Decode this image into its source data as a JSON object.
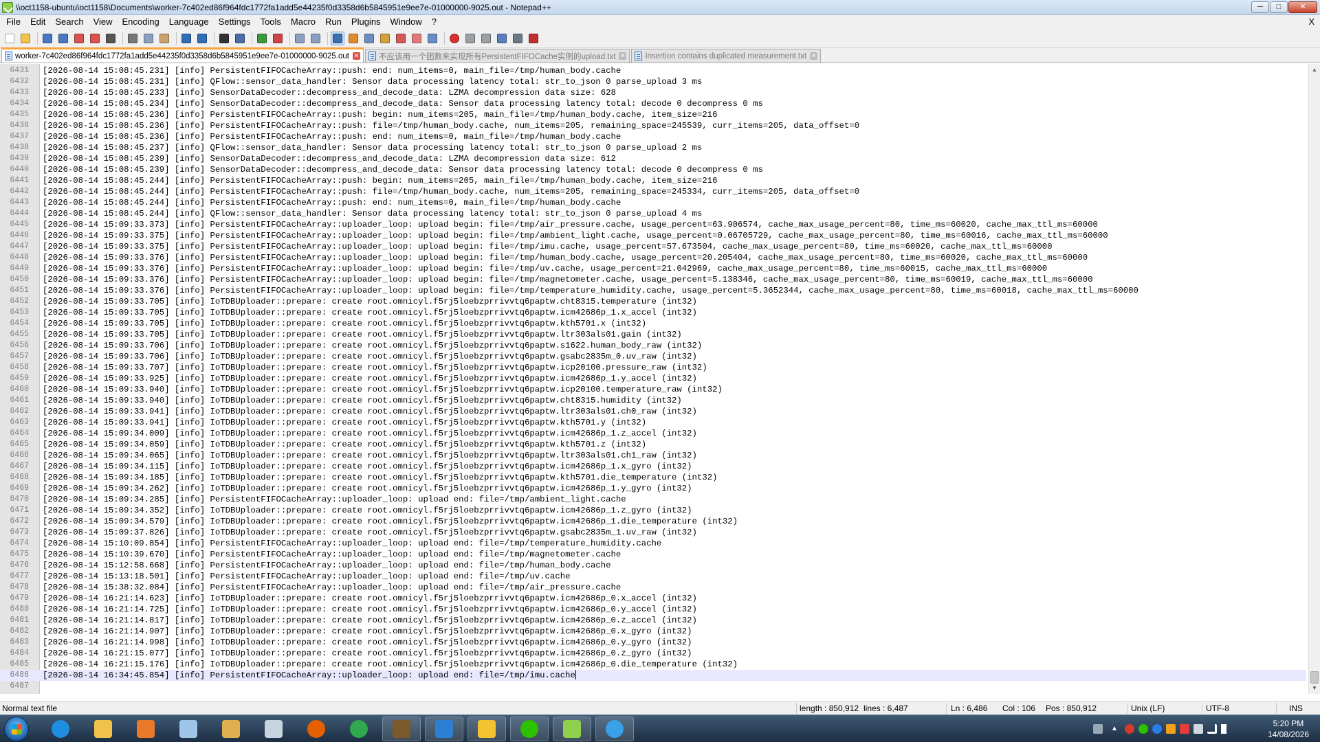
{
  "window": {
    "title": "\\\\oct1158-ubuntu\\oct1158\\Documents\\worker-7c402ed86f964fdc1772fa1add5e44235f0d3358d6b5845951e9ee7e-01000000-9025.out - Notepad++",
    "minimize_glyph": "─",
    "maximize_glyph": "□",
    "close_glyph": "✕"
  },
  "menu": {
    "items": [
      "File",
      "Edit",
      "Search",
      "View",
      "Encoding",
      "Language",
      "Settings",
      "Tools",
      "Macro",
      "Run",
      "Plugins",
      "Window",
      "?"
    ],
    "close_glyph": "X"
  },
  "toolbar": {
    "icons": [
      "new-file-icon",
      "open-file-icon",
      "save-icon",
      "save-all-icon",
      "close-icon",
      "close-all-icon",
      "print-icon",
      "cut-icon",
      "copy-icon",
      "paste-icon",
      "undo-icon",
      "redo-icon",
      "find-icon",
      "replace-icon",
      "zoom-in-icon",
      "zoom-out-icon",
      "sync-vertical-icon",
      "sync-horizontal-icon",
      "word-wrap-icon",
      "show-all-chars-icon",
      "indent-guide-icon",
      "document-map-icon",
      "function-list-icon",
      "folder-workspace-icon",
      "monitor-icon",
      "record-macro-icon",
      "stop-macro-icon",
      "play-macro-icon",
      "run-macro-multiple-icon",
      "save-macro-icon",
      "spell-check-icon"
    ]
  },
  "tabs": [
    {
      "label": "worker-7c402ed86f964fdc1772fa1add5e44235f0d3358d6b5845951e9ee7e-01000000-9025.out",
      "active": true
    },
    {
      "label": "不应该用一个团数来实现所有PersistentFIFOCache实例的upload.txt",
      "active": false
    },
    {
      "label": "Insertion contains duplicated measurement.txt",
      "active": false
    }
  ],
  "editor": {
    "current_line": 6486,
    "lines": [
      {
        "n": "6431",
        "t": "[2026-08-14 15:08:45.231] [info] PersistentFIFOCacheArray::push: end: num_items=0, main_file=/tmp/human_body.cache"
      },
      {
        "n": "6432",
        "t": "[2026-08-14 15:08:45.231] [info] QFlow::sensor_data_handler: Sensor data processing latency total: str_to_json 0 parse_upload 3 ms"
      },
      {
        "n": "6433",
        "t": "[2026-08-14 15:08:45.233] [info] SensorDataDecoder::decompress_and_decode_data: LZMA decompression data size: 628"
      },
      {
        "n": "6434",
        "t": "[2026-08-14 15:08:45.234] [info] SensorDataDecoder::decompress_and_decode_data: Sensor data processing latency total: decode 0 decompress 0 ms"
      },
      {
        "n": "6435",
        "t": "[2026-08-14 15:08:45.236] [info] PersistentFIFOCacheArray::push: begin: num_items=205, main_file=/tmp/human_body.cache, item_size=216"
      },
      {
        "n": "6436",
        "t": "[2026-08-14 15:08:45.236] [info] PersistentFIFOCacheArray::push: file=/tmp/human_body.cache, num_items=205, remaining_space=245539, curr_items=205, data_offset=0"
      },
      {
        "n": "6437",
        "t": "[2026-08-14 15:08:45.236] [info] PersistentFIFOCacheArray::push: end: num_items=0, main_file=/tmp/human_body.cache"
      },
      {
        "n": "6438",
        "t": "[2026-08-14 15:08:45.237] [info] QFlow::sensor_data_handler: Sensor data processing latency total: str_to_json 0 parse_upload 2 ms"
      },
      {
        "n": "6439",
        "t": "[2026-08-14 15:08:45.239] [info] SensorDataDecoder::decompress_and_decode_data: LZMA decompression data size: 612"
      },
      {
        "n": "6440",
        "t": "[2026-08-14 15:08:45.239] [info] SensorDataDecoder::decompress_and_decode_data: Sensor data processing latency total: decode 0 decompress 0 ms"
      },
      {
        "n": "6441",
        "t": "[2026-08-14 15:08:45.244] [info] PersistentFIFOCacheArray::push: begin: num_items=205, main_file=/tmp/human_body.cache, item_size=216"
      },
      {
        "n": "6442",
        "t": "[2026-08-14 15:08:45.244] [info] PersistentFIFOCacheArray::push: file=/tmp/human_body.cache, num_items=205, remaining_space=245334, curr_items=205, data_offset=0"
      },
      {
        "n": "6443",
        "t": "[2026-08-14 15:08:45.244] [info] PersistentFIFOCacheArray::push: end: num_items=0, main_file=/tmp/human_body.cache"
      },
      {
        "n": "6444",
        "t": "[2026-08-14 15:08:45.244] [info] QFlow::sensor_data_handler: Sensor data processing latency total: str_to_json 0 parse_upload 4 ms"
      },
      {
        "n": "6445",
        "t": "[2026-08-14 15:09:33.373] [info] PersistentFIFOCacheArray::uploader_loop: upload begin: file=/tmp/air_pressure.cache, usage_percent=63.906574, cache_max_usage_percent=80, time_ms=60020, cache_max_ttl_ms=60000"
      },
      {
        "n": "6446",
        "t": "[2026-08-14 15:09:33.375] [info] PersistentFIFOCacheArray::uploader_loop: upload begin: file=/tmp/ambient_light.cache, usage_percent=0.06705729, cache_max_usage_percent=80, time_ms=60016, cache_max_ttl_ms=60000"
      },
      {
        "n": "6447",
        "t": "[2026-08-14 15:09:33.375] [info] PersistentFIFOCacheArray::uploader_loop: upload begin: file=/tmp/imu.cache, usage_percent=57.673504, cache_max_usage_percent=80, time_ms=60020, cache_max_ttl_ms=60000"
      },
      {
        "n": "6448",
        "t": "[2026-08-14 15:09:33.376] [info] PersistentFIFOCacheArray::uploader_loop: upload begin: file=/tmp/human_body.cache, usage_percent=20.205404, cache_max_usage_percent=80, time_ms=60020, cache_max_ttl_ms=60000"
      },
      {
        "n": "6449",
        "t": "[2026-08-14 15:09:33.376] [info] PersistentFIFOCacheArray::uploader_loop: upload begin: file=/tmp/uv.cache, usage_percent=21.042969, cache_max_usage_percent=80, time_ms=60015, cache_max_ttl_ms=60000"
      },
      {
        "n": "6450",
        "t": "[2026-08-14 15:09:33.376] [info] PersistentFIFOCacheArray::uploader_loop: upload begin: file=/tmp/magnetometer.cache, usage_percent=5.138346, cache_max_usage_percent=80, time_ms=60019, cache_max_ttl_ms=60000"
      },
      {
        "n": "6451",
        "t": "[2026-08-14 15:09:33.376] [info] PersistentFIFOCacheArray::uploader_loop: upload begin: file=/tmp/temperature_humidity.cache, usage_percent=5.3652344, cache_max_usage_percent=80, time_ms=60018, cache_max_ttl_ms=60000"
      },
      {
        "n": "6452",
        "t": "[2026-08-14 15:09:33.705] [info] IoTDBUploader::prepare: create root.omnicyl.f5rj5loebzprrivvtq6paptw.cht8315.temperature (int32)"
      },
      {
        "n": "6453",
        "t": "[2026-08-14 15:09:33.705] [info] IoTDBUploader::prepare: create root.omnicyl.f5rj5loebzprrivvtq6paptw.icm42686p_1.x_accel (int32)"
      },
      {
        "n": "6454",
        "t": "[2026-08-14 15:09:33.705] [info] IoTDBUploader::prepare: create root.omnicyl.f5rj5loebzprrivvtq6paptw.kth5701.x (int32)"
      },
      {
        "n": "6455",
        "t": "[2026-08-14 15:09:33.705] [info] IoTDBUploader::prepare: create root.omnicyl.f5rj5loebzprrivvtq6paptw.ltr303als01.gain (int32)"
      },
      {
        "n": "6456",
        "t": "[2026-08-14 15:09:33.706] [info] IoTDBUploader::prepare: create root.omnicyl.f5rj5loebzprrivvtq6paptw.s1622.human_body_raw (int32)"
      },
      {
        "n": "6457",
        "t": "[2026-08-14 15:09:33.706] [info] IoTDBUploader::prepare: create root.omnicyl.f5rj5loebzprrivvtq6paptw.gsabc2835m_0.uv_raw (int32)"
      },
      {
        "n": "6458",
        "t": "[2026-08-14 15:09:33.707] [info] IoTDBUploader::prepare: create root.omnicyl.f5rj5loebzprrivvtq6paptw.icp20100.pressure_raw (int32)"
      },
      {
        "n": "6459",
        "t": "[2026-08-14 15:09:33.925] [info] IoTDBUploader::prepare: create root.omnicyl.f5rj5loebzprrivvtq6paptw.icm42686p_1.y_accel (int32)"
      },
      {
        "n": "6460",
        "t": "[2026-08-14 15:09:33.940] [info] IoTDBUploader::prepare: create root.omnicyl.f5rj5loebzprrivvtq6paptw.icp20100.temperature_raw (int32)"
      },
      {
        "n": "6461",
        "t": "[2026-08-14 15:09:33.940] [info] IoTDBUploader::prepare: create root.omnicyl.f5rj5loebzprrivvtq6paptw.cht8315.humidity (int32)"
      },
      {
        "n": "6462",
        "t": "[2026-08-14 15:09:33.941] [info] IoTDBUploader::prepare: create root.omnicyl.f5rj5loebzprrivvtq6paptw.ltr303als01.ch0_raw (int32)"
      },
      {
        "n": "6463",
        "t": "[2026-08-14 15:09:33.941] [info] IoTDBUploader::prepare: create root.omnicyl.f5rj5loebzprrivvtq6paptw.kth5701.y (int32)"
      },
      {
        "n": "6464",
        "t": "[2026-08-14 15:09:34.009] [info] IoTDBUploader::prepare: create root.omnicyl.f5rj5loebzprrivvtq6paptw.icm42686p_1.z_accel (int32)"
      },
      {
        "n": "6465",
        "t": "[2026-08-14 15:09:34.059] [info] IoTDBUploader::prepare: create root.omnicyl.f5rj5loebzprrivvtq6paptw.kth5701.z (int32)"
      },
      {
        "n": "6466",
        "t": "[2026-08-14 15:09:34.065] [info] IoTDBUploader::prepare: create root.omnicyl.f5rj5loebzprrivvtq6paptw.ltr303als01.ch1_raw (int32)"
      },
      {
        "n": "6467",
        "t": "[2026-08-14 15:09:34.115] [info] IoTDBUploader::prepare: create root.omnicyl.f5rj5loebzprrivvtq6paptw.icm42686p_1.x_gyro (int32)"
      },
      {
        "n": "6468",
        "t": "[2026-08-14 15:09:34.185] [info] IoTDBUploader::prepare: create root.omnicyl.f5rj5loebzprrivvtq6paptw.kth5701.die_temperature (int32)"
      },
      {
        "n": "6469",
        "t": "[2026-08-14 15:09:34.262] [info] IoTDBUploader::prepare: create root.omnicyl.f5rj5loebzprrivvtq6paptw.icm42686p_1.y_gyro (int32)"
      },
      {
        "n": "6470",
        "t": "[2026-08-14 15:09:34.285] [info] PersistentFIFOCacheArray::uploader_loop: upload end: file=/tmp/ambient_light.cache"
      },
      {
        "n": "6471",
        "t": "[2026-08-14 15:09:34.352] [info] IoTDBUploader::prepare: create root.omnicyl.f5rj5loebzprrivvtq6paptw.icm42686p_1.z_gyro (int32)"
      },
      {
        "n": "6472",
        "t": "[2026-08-14 15:09:34.579] [info] IoTDBUploader::prepare: create root.omnicyl.f5rj5loebzprrivvtq6paptw.icm42686p_1.die_temperature (int32)"
      },
      {
        "n": "6473",
        "t": "[2026-08-14 15:09:37.826] [info] IoTDBUploader::prepare: create root.omnicyl.f5rj5loebzprrivvtq6paptw.gsabc2835m_1.uv_raw (int32)"
      },
      {
        "n": "6474",
        "t": "[2026-08-14 15:10:09.854] [info] PersistentFIFOCacheArray::uploader_loop: upload end: file=/tmp/temperature_humidity.cache"
      },
      {
        "n": "6475",
        "t": "[2026-08-14 15:10:39.670] [info] PersistentFIFOCacheArray::uploader_loop: upload end: file=/tmp/magnetometer.cache"
      },
      {
        "n": "6476",
        "t": "[2026-08-14 15:12:58.668] [info] PersistentFIFOCacheArray::uploader_loop: upload end: file=/tmp/human_body.cache"
      },
      {
        "n": "6477",
        "t": "[2026-08-14 15:13:18.501] [info] PersistentFIFOCacheArray::uploader_loop: upload end: file=/tmp/uv.cache"
      },
      {
        "n": "6478",
        "t": "[2026-08-14 15:38:32.084] [info] PersistentFIFOCacheArray::uploader_loop: upload end: file=/tmp/air_pressure.cache"
      },
      {
        "n": "6479",
        "t": "[2026-08-14 16:21:14.623] [info] IoTDBUploader::prepare: create root.omnicyl.f5rj5loebzprrivvtq6paptw.icm42686p_0.x_accel (int32)"
      },
      {
        "n": "6480",
        "t": "[2026-08-14 16:21:14.725] [info] IoTDBUploader::prepare: create root.omnicyl.f5rj5loebzprrivvtq6paptw.icm42686p_0.y_accel (int32)"
      },
      {
        "n": "6481",
        "t": "[2026-08-14 16:21:14.817] [info] IoTDBUploader::prepare: create root.omnicyl.f5rj5loebzprrivvtq6paptw.icm42686p_0.z_accel (int32)"
      },
      {
        "n": "6482",
        "t": "[2026-08-14 16:21:14.907] [info] IoTDBUploader::prepare: create root.omnicyl.f5rj5loebzprrivvtq6paptw.icm42686p_0.x_gyro (int32)"
      },
      {
        "n": "6483",
        "t": "[2026-08-14 16:21:14.998] [info] IoTDBUploader::prepare: create root.omnicyl.f5rj5loebzprrivvtq6paptw.icm42686p_0.y_gyro (int32)"
      },
      {
        "n": "6484",
        "t": "[2026-08-14 16:21:15.077] [info] IoTDBUploader::prepare: create root.omnicyl.f5rj5loebzprrivvtq6paptw.icm42686p_0.z_gyro (int32)"
      },
      {
        "n": "6485",
        "t": "[2026-08-14 16:21:15.176] [info] IoTDBUploader::prepare: create root.omnicyl.f5rj5loebzprrivvtq6paptw.icm42686p_0.die_temperature (int32)"
      },
      {
        "n": "6486",
        "t": "[2026-08-14 16:34:45.854] [info] PersistentFIFOCacheArray::uploader_loop: upload end: file=/tmp/imu.cache"
      },
      {
        "n": "6487",
        "t": ""
      }
    ]
  },
  "status": {
    "file_type": "Normal text file",
    "length": "length : 850,912",
    "lines": "lines : 6,487",
    "ln": "Ln : 6,486",
    "col": "Col : 106",
    "pos": "Pos : 850,912",
    "eol": "Unix (LF)",
    "encoding": "UTF-8",
    "mode": "INS"
  },
  "taskbar": {
    "apps": [
      "internet-explorer-icon",
      "file-explorer-icon",
      "media-player-icon",
      "notepad-icon",
      "paint-icon",
      "calculator-icon",
      "firefox-icon",
      "chrome-icon",
      "game-icon",
      "vscode-icon",
      "text-editor-icon",
      "wechat-icon",
      "notepadpp-icon",
      "network-tool-icon"
    ],
    "time": "5:20 PM",
    "date": "14/08/2026"
  },
  "colors": {
    "active_tab_accent": "#f9a33a",
    "current_line": "#e8e8ff",
    "gutter": "#e4e4e4"
  }
}
